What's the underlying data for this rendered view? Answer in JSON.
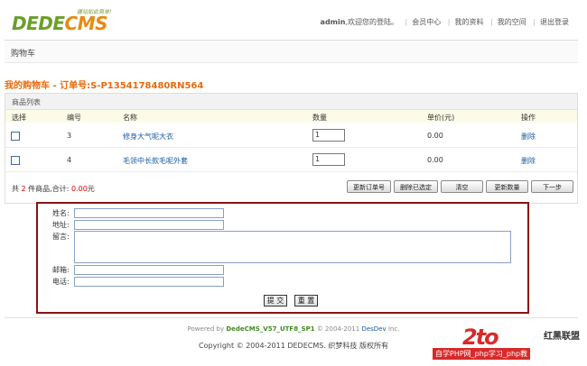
{
  "header": {
    "logo_part1": "DEDE",
    "logo_part2": "CMS",
    "slogan": "建站如此简单!",
    "user": "admin",
    "welcome": ",欢迎您的登陆。",
    "nav": [
      "会员中心",
      "我的资料",
      "我的空间",
      "退出登录"
    ]
  },
  "breadcrumb": "购物车",
  "cart_title": "我的购物车 - 订单号:S-P1354178480RN564",
  "panel_title": "商品列表",
  "table": {
    "headers": [
      "选择",
      "编号",
      "名称",
      "数量",
      "单价(元)",
      "操作"
    ],
    "rows": [
      {
        "id": "3",
        "name": "修身大气呢大衣",
        "qty": "1",
        "price": "0.00",
        "action": "删除"
      },
      {
        "id": "4",
        "name": "毛领中长款毛呢外套",
        "qty": "1",
        "price": "0.00",
        "action": "删除"
      }
    ]
  },
  "summary": {
    "prefix": "共 ",
    "count": "2",
    "middle": " 件商品,合计: ",
    "total": "0.00",
    "suffix": "元"
  },
  "buttons": [
    "更新订单号",
    "删除已选定",
    "清空",
    "更新数量",
    "下一步"
  ],
  "form": {
    "name_label": "姓名:",
    "address_label": "地址:",
    "message_label": "留言:",
    "zip_label": "邮箱:",
    "phone_label": "电话:",
    "submit": "提 交",
    "reset": "重 置"
  },
  "footer": {
    "powered_prefix": "Powered by ",
    "powered_product": "DedeCMS_V57_UTF8_SP1",
    "powered_mid": " © 2004-2011 ",
    "powered_company": "DesDev",
    "powered_suffix": " Inc.",
    "copyright": "Copyright © 2004-2011 DEDECMS. 织梦科技 版权所有"
  },
  "watermark": {
    "big": "2to",
    "brand": "红黑联盟",
    "sub": "自学PHP网_php学习_php教"
  }
}
